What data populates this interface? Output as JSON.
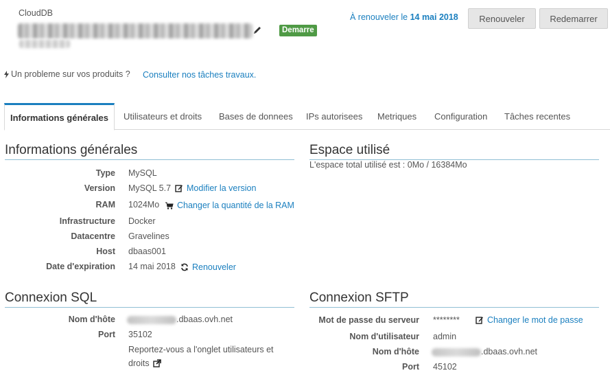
{
  "header": {
    "product_type": "CloudDB",
    "status": "Demarre",
    "renew_prefix": "À renouveler le",
    "renew_date": "14 mai 2018",
    "renew_button": "Renouveler",
    "restart_button": "Redemarrer"
  },
  "help": {
    "problem_text": "Un probleme sur vos produits ?",
    "works_link": "Consulter nos tâches travaux."
  },
  "tabs": [
    {
      "label": "Informations générales",
      "active": true
    },
    {
      "label": "Utilisateurs et droits"
    },
    {
      "label": "Bases de donnees"
    },
    {
      "label": "IPs autorisees"
    },
    {
      "label": "Metriques"
    },
    {
      "label": "Configuration"
    },
    {
      "label": "Tâches recentes"
    }
  ],
  "general": {
    "title": "Informations générales",
    "rows": [
      {
        "label": "Type",
        "value": "MySQL"
      },
      {
        "label": "Version",
        "value": "MySQL 5.7",
        "action": "Modifier la version",
        "action_icon": "edit-icon"
      },
      {
        "label": "RAM",
        "value": "1024Mo",
        "action": "Changer la quantité de la RAM",
        "action_icon": "cart-icon"
      },
      {
        "label": "Infrastructure",
        "value": "Docker"
      },
      {
        "label": "Datacentre",
        "value": "Gravelines"
      },
      {
        "label": "Host",
        "value": "dbaas001"
      },
      {
        "label": "Date d'expiration",
        "value": "14 mai 2018",
        "action": "Renouveler",
        "action_icon": "refresh-icon"
      }
    ]
  },
  "space": {
    "title": "Espace utilisé",
    "text": "L'espace total utilisé est : 0Mo / 16384Mo"
  },
  "sql": {
    "title": "Connexion SQL",
    "host_label": "Nom d'hôte",
    "host_suffix": ".dbaas.ovh.net",
    "port_label": "Port",
    "port_value": "35102",
    "note_line1": "Reportez-vous a l'onglet utilisateurs et",
    "note_line2": "droits"
  },
  "sftp": {
    "title": "Connexion SFTP",
    "password_label": "Mot de passe du serveur",
    "password_value": "********",
    "password_action": "Changer le mot de passe",
    "user_label": "Nom d'utilisateur",
    "user_value": "admin",
    "host_label": "Nom d'hôte",
    "host_suffix": ".dbaas.ovh.net",
    "port_label": "Port",
    "port_value": "45102"
  },
  "colors": {
    "link": "#1a7fbf",
    "status_green": "#4f9a45",
    "section_underline": "#8fbfd4"
  }
}
